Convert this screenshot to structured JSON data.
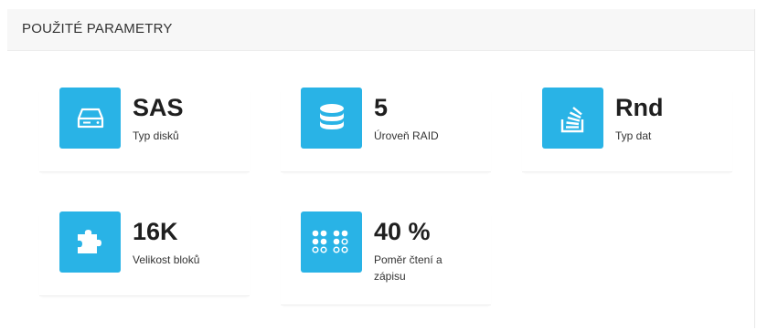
{
  "panel": {
    "title": "POUŽITÉ PARAMETRY"
  },
  "stats": [
    {
      "value": "SAS",
      "label": "Typ disků",
      "icon": "hard-drive-icon"
    },
    {
      "value": "5",
      "label": "Úroveň RAID",
      "icon": "database-icon"
    },
    {
      "value": "Rnd",
      "label": "Typ dat",
      "icon": "stack-icon"
    },
    {
      "value": "16K",
      "label": "Velikost bloků",
      "icon": "puzzle-icon"
    },
    {
      "value": "40 %",
      "label": "Poměr čtení a zápisu",
      "icon": "dots-grid-icon"
    }
  ],
  "colors": {
    "accent": "#29b3e6",
    "header_bg": "#f7f7f7"
  }
}
